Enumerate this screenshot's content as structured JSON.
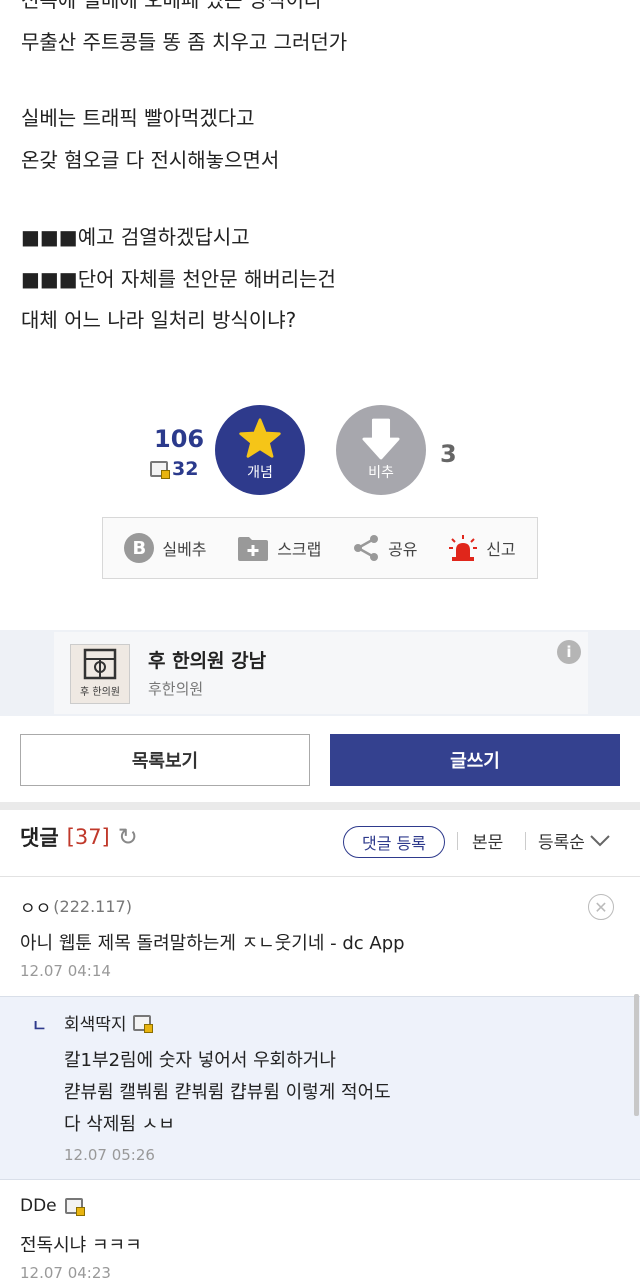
{
  "post": {
    "lines": [
      "전독에 실베에 오베페 있는 방식이라",
      "무출산 주트콩들 똥 좀 치우고 그러던가",
      "실베는 트래픽 빨아먹겠다고",
      "온갖 혐오글 다 전시해놓으면서",
      "■■■예고 검열하겠답시고",
      "■■■단어 자체를 천안문 해버리는건",
      "대체 어느 나라 일처리 방식이냐?"
    ]
  },
  "vote": {
    "up_count": "106",
    "fixed_count": "32",
    "up_label": "개념",
    "down_label": "비추",
    "down_count": "3"
  },
  "actions": {
    "b_letter": "B",
    "silbe": "실베추",
    "scrap": "스크랩",
    "share": "공유",
    "report": "신고"
  },
  "ad": {
    "title": "후 한의원 강남",
    "subtitle": "후한의원",
    "logo_text": "후 한의원",
    "info": "i"
  },
  "buttons": {
    "list": "목록보기",
    "write": "글쓰기"
  },
  "comments_header": {
    "title": "댓글",
    "count": "[37]",
    "register": "댓글 등록",
    "body": "본문",
    "sort": "등록순"
  },
  "comments": [
    {
      "author": "ㅇㅇ",
      "ip": "(222.117)",
      "text": "아니 웹툰 제목 돌려말하는게 ㅈㄴ웃기네 - dc App",
      "time": "12.07 04:14"
    },
    {
      "author": "DDe",
      "text": "전독시냐 ㅋㅋㅋ",
      "time": "12.07 04:23"
    }
  ],
  "reply": {
    "mark": "ㄴ",
    "author": "회색딱지",
    "lines": [
      "칼1부2림에 숫자 넣어서 우회하거나",
      "캳뷰륌 캘붜륌 캳붜륌 캽뷰륌 이렇게 적어도",
      "다 삭제됨 ㅅㅂ"
    ],
    "time": "12.07 05:26"
  },
  "colors": {
    "accent": "#2e3a8c",
    "down": "#a7a7ad",
    "count_red": "#c0392b",
    "report_red": "#e0261b",
    "star": "#f5c518"
  },
  "icons": [
    "star-icon",
    "down-arrow-icon",
    "bookmark-b-icon",
    "folder-plus-icon",
    "share-icon",
    "siren-icon",
    "refresh-icon",
    "close-circle-icon",
    "fixed-member-icon",
    "chevron-down-icon",
    "info-icon"
  ]
}
